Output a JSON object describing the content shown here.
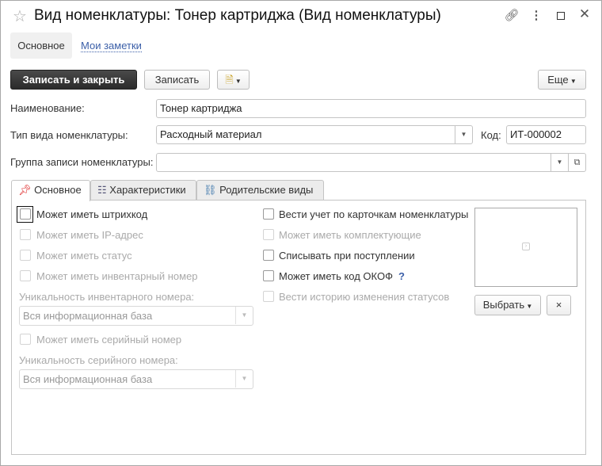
{
  "window": {
    "title": "Вид номенклатуры: Тонер картриджа (Вид номенклатуры)"
  },
  "nav": {
    "main": "Основное",
    "notes": "Мои заметки"
  },
  "toolbar": {
    "save_close": "Записать и закрыть",
    "save": "Записать",
    "more": "Еще"
  },
  "fields": {
    "name_label": "Наименование:",
    "name_value": "Тонер картриджа",
    "type_label": "Тип вида номенклатуры:",
    "type_value": "Расходный материал",
    "code_label": "Код:",
    "code_value": "ИТ-000002",
    "group_label": "Группа записи номенклатуры:",
    "group_value": ""
  },
  "tabs": [
    "Основное",
    "Характеристики",
    "Родительские виды"
  ],
  "left": {
    "cb1": "Может иметь штрихкод",
    "cb2": "Может иметь IP-адрес",
    "cb3": "Может иметь статус",
    "cb4": "Может иметь инвентарный номер",
    "inv_label": "Уникальность инвентарного номера:",
    "inv_value": "Вся информационная база",
    "cb5": "Может иметь серийный номер",
    "ser_label": "Уникальность серийного номера:",
    "ser_value": "Вся информационная база"
  },
  "right": {
    "cb1": "Вести учет по карточкам номенклатуры",
    "cb2": "Может иметь комплектующие",
    "cb3": "Списывать при поступлении",
    "cb4": "Может иметь код ОКОФ",
    "help": "?",
    "cb5": "Вести историю изменения статусов"
  },
  "picture": {
    "select": "Выбрать",
    "clear": "×"
  }
}
